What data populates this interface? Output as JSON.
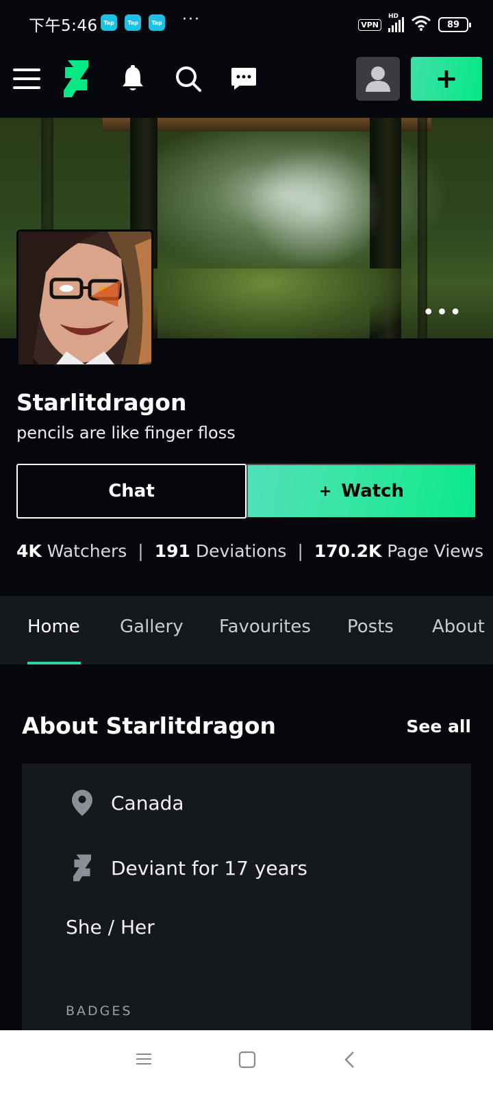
{
  "status_bar": {
    "time": "下午5:46",
    "tap_labels": [
      "Tap",
      "Tap",
      "Tap"
    ],
    "more": "···",
    "vpn": "VPN",
    "network": "HD",
    "battery": "89"
  },
  "top_nav": {
    "icons": [
      "menu-icon",
      "deviantart-logo-icon",
      "bell-icon",
      "search-icon",
      "message-icon",
      "profile-avatar-icon",
      "plus-icon"
    ],
    "create_label": "+"
  },
  "profile": {
    "username": "Starlitdragon",
    "tagline": "pencils are like finger floss",
    "cover_more": "•••"
  },
  "actions": {
    "chat": "Chat",
    "watch_plus": "+",
    "watch": "Watch"
  },
  "stats": {
    "watchers_count": "4K",
    "watchers_label": "Watchers",
    "deviations_count": "191",
    "deviations_label": "Deviations",
    "views_count": "170.2K",
    "views_label": "Page Views",
    "separator": "|"
  },
  "tabs": [
    "Home",
    "Gallery",
    "Favourites",
    "Posts",
    "About"
  ],
  "active_tab": "Home",
  "about": {
    "title": "About Starlitdragon",
    "see_all": "See all",
    "location": "Canada",
    "deviant_for": "Deviant for 17 years",
    "pronouns": "She / Her",
    "badges_label": "BADGES"
  },
  "colors": {
    "accent": "#05e885",
    "background": "#06070d",
    "card": "#15181d"
  }
}
